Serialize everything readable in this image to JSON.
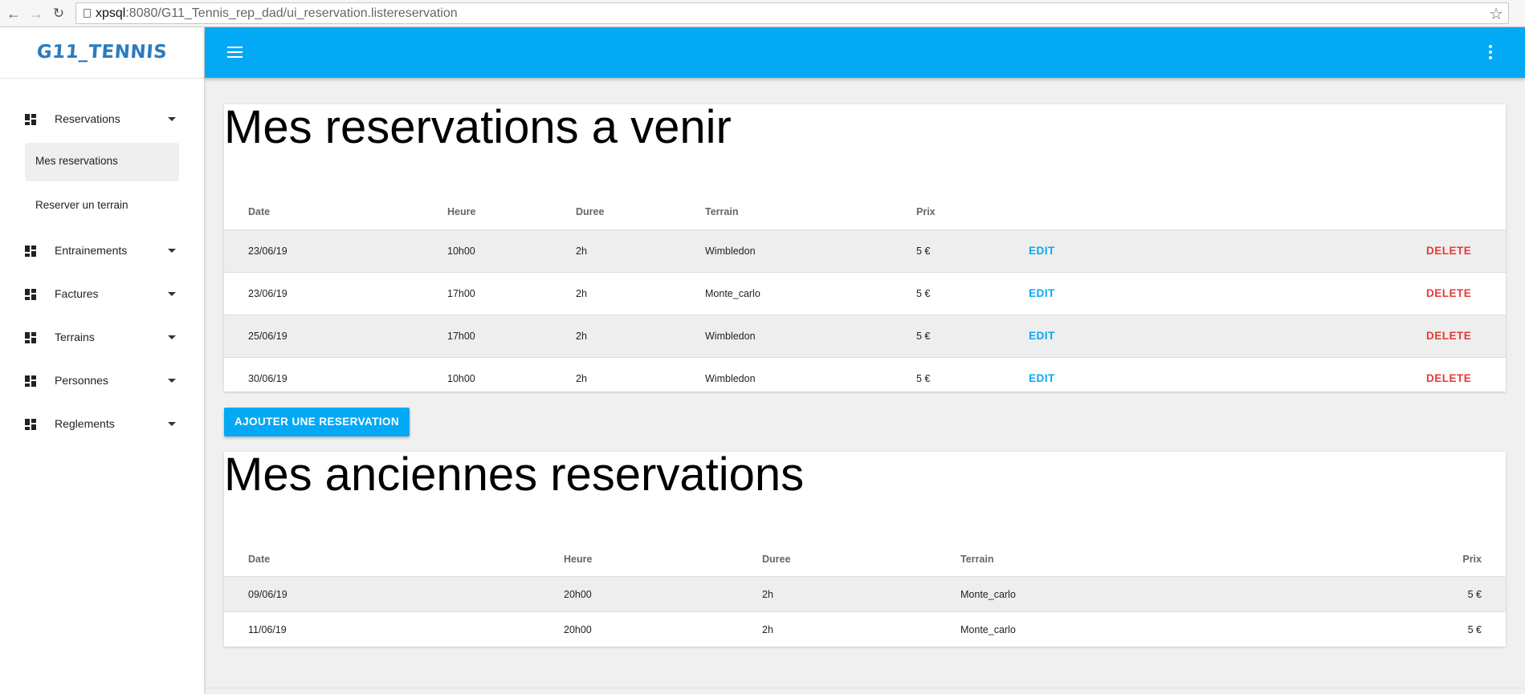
{
  "browser": {
    "url_host": "xpsql",
    "url_rest": ":8080/G11_Tennis_rep_dad/ui_reservation.listereservation"
  },
  "app": {
    "logo": "G11_TENNIS"
  },
  "sidebar": {
    "items": [
      {
        "label": "Reservations",
        "icon": "dashboard-icon",
        "expanded": true
      },
      {
        "label": "Entrainements",
        "icon": "dashboard-icon"
      },
      {
        "label": "Factures",
        "icon": "dashboard-icon"
      },
      {
        "label": "Terrains",
        "icon": "dashboard-icon"
      },
      {
        "label": "Personnes",
        "icon": "dashboard-icon"
      },
      {
        "label": "Reglements",
        "icon": "dashboard-icon"
      }
    ],
    "subitems": [
      {
        "label": "Mes reservations",
        "active": true
      },
      {
        "label": "Reserver un terrain"
      }
    ]
  },
  "upcoming": {
    "title": "Mes reservations a venir",
    "headers": {
      "date": "Date",
      "heure": "Heure",
      "duree": "Duree",
      "terrain": "Terrain",
      "prix": "Prix"
    },
    "rows": [
      {
        "date": "23/06/19",
        "heure": "10h00",
        "duree": "2h",
        "terrain": "Wimbledon",
        "prix": "5 €",
        "edit": "EDIT",
        "delete": "DELETE"
      },
      {
        "date": "23/06/19",
        "heure": "17h00",
        "duree": "2h",
        "terrain": "Monte_carlo",
        "prix": "5 €",
        "edit": "EDIT",
        "delete": "DELETE"
      },
      {
        "date": "25/06/19",
        "heure": "17h00",
        "duree": "2h",
        "terrain": "Wimbledon",
        "prix": "5 €",
        "edit": "EDIT",
        "delete": "DELETE"
      },
      {
        "date": "30/06/19",
        "heure": "10h00",
        "duree": "2h",
        "terrain": "Wimbledon",
        "prix": "5 €",
        "edit": "EDIT",
        "delete": "DELETE"
      }
    ],
    "add_button": "AJOUTER UNE RESERVATION"
  },
  "past": {
    "title": "Mes anciennes reservations",
    "headers": {
      "date": "Date",
      "heure": "Heure",
      "duree": "Duree",
      "terrain": "Terrain",
      "prix": "Prix"
    },
    "rows": [
      {
        "date": "09/06/19",
        "heure": "20h00",
        "duree": "2h",
        "terrain": "Monte_carlo",
        "prix": "5 €"
      },
      {
        "date": "11/06/19",
        "heure": "20h00",
        "duree": "2h",
        "terrain": "Monte_carlo",
        "prix": "5 €"
      }
    ]
  },
  "colors": {
    "primary": "#03a9f4",
    "danger": "#e53935",
    "logo": "#2a7cc0"
  }
}
